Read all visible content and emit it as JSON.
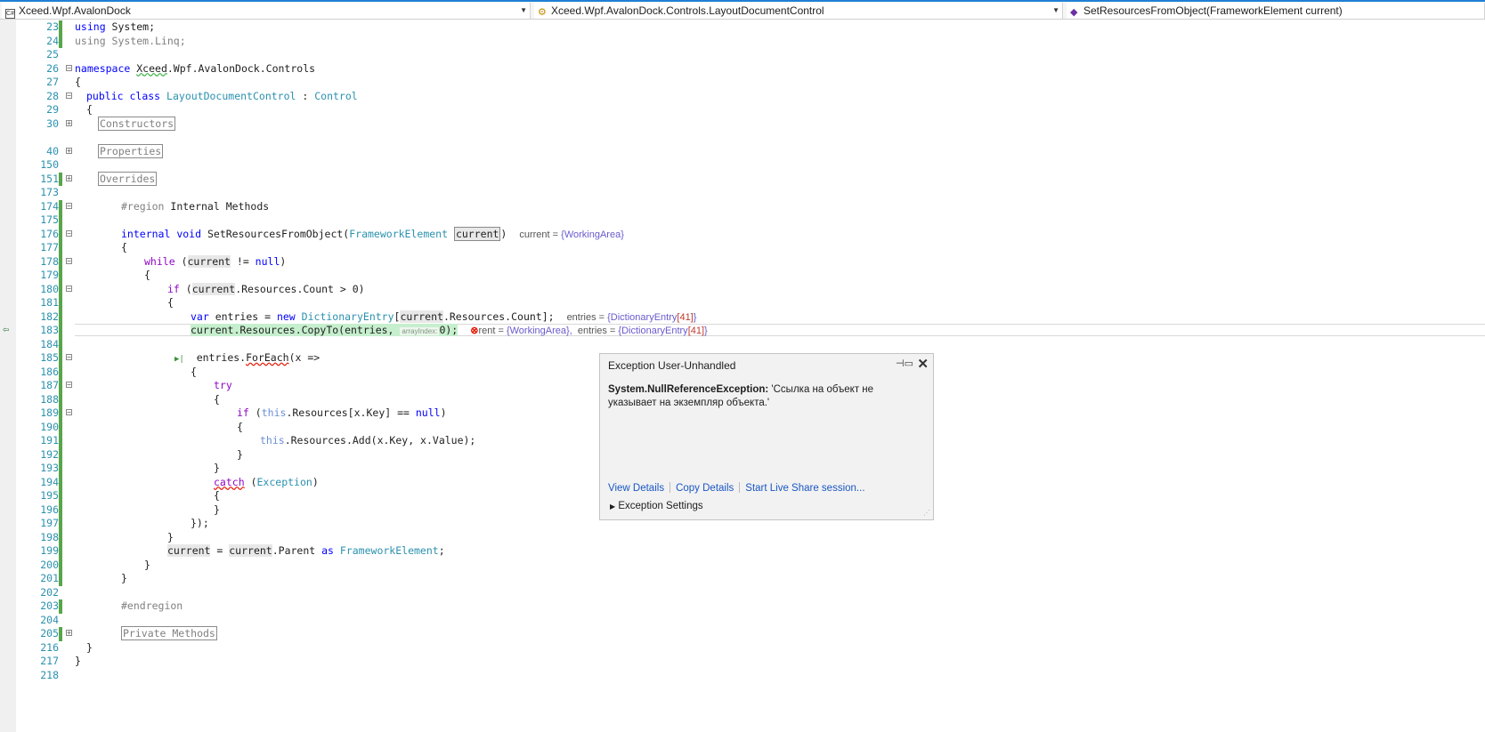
{
  "navbar": {
    "project": "Xceed.Wpf.AvalonDock",
    "class": "Xceed.Wpf.AvalonDock.Controls.LayoutDocumentControl",
    "member": "SetResourcesFromObject(FrameworkElement current)"
  },
  "lines": {
    "l23": "23",
    "l24": "24",
    "l25": "25",
    "l26": "26",
    "l27": "27",
    "l28": "28",
    "l29": "29",
    "l30": "30",
    "l40": "40",
    "l150": "150",
    "l151": "151",
    "l173": "173",
    "l174": "174",
    "l175": "175",
    "l176": "176",
    "l177": "177",
    "l178": "178",
    "l179": "179",
    "l180": "180",
    "l181": "181",
    "l182": "182",
    "l183": "183",
    "l184": "184",
    "l185": "185",
    "l186": "186",
    "l187": "187",
    "l188": "188",
    "l189": "189",
    "l190": "190",
    "l191": "191",
    "l192": "192",
    "l193": "193",
    "l194": "194",
    "l195": "195",
    "l196": "196",
    "l197": "197",
    "l198": "198",
    "l199": "199",
    "l200": "200",
    "l201": "201",
    "l202": "202",
    "l203": "203",
    "l204": "204",
    "l205": "205",
    "l216": "216",
    "l217": "217",
    "l218": "218"
  },
  "code": {
    "kw_using": "using",
    "system": " System;",
    "linq": "using System.Linq;",
    "kw_namespace": "namespace",
    "ns_xceed": "Xceed",
    "ns_rest": ".Wpf.AvalonDock.Controls",
    "brace_open": "{",
    "brace_close": "}",
    "kw_public": "public",
    "kw_class": "class",
    "class_name": "LayoutDocumentControl",
    "colon": " : ",
    "control": "Control",
    "region_constructors": "Constructors",
    "region_properties": "Properties",
    "region_overrides": "Overrides",
    "region_kw": "#region",
    "region_internal": " Internal Methods",
    "kw_internal": "internal",
    "kw_void": "void",
    "method_name": "SetResourcesFromObject",
    "paren_open": "(",
    "fe": "FrameworkElement",
    "current": "current",
    "paren_close": ")",
    "tip_current_label": "current = ",
    "tip_current_val": "{WorkingArea}",
    "kw_while": "while",
    "neq_null_a": " != ",
    "kw_null": "null",
    "kw_if": "if",
    "res_count_gt": ".Resources.Count > 0)",
    "kw_var": "var",
    "entries_assign": " entries = ",
    "kw_new": "new",
    "dict_entry": "DictionaryEntry",
    "bracket_open": "[",
    "res_count_close": ".Resources.Count];",
    "tip_entries_label": "entries = ",
    "tip_entries_type": "{DictionaryEntry",
    "tip_entries_num": "[41]",
    "tip_entries_end": "}",
    "copyto_a": "current.Resources.CopyTo(entries, ",
    "chip_array_index": "arrayIndex:",
    "copyto_b": "0);",
    "tip183_a": "rent = ",
    "tip183_b": "{WorkingArea},",
    "tip183_c": "entries = ",
    "foreach_a": "entries.",
    "foreach_m": "ForEach",
    "foreach_b": "(x =>",
    "kw_try": "try",
    "kw_this": "this",
    "res_key_a": ".Resources[",
    "x": "x",
    "res_key_b": ".Key] == ",
    "kw_null2": "null",
    "add_a": ".Resources.",
    "add_m": "Add",
    "add_b": "(x.Key, x.Value);",
    "kw_catch": "catch",
    "exception_type": "Exception",
    "close_lambda": "});",
    "parent_assign": " = ",
    "parent_b": ".Parent ",
    "kw_as": "as",
    "semicolon": ";",
    "endregion": "#endregion",
    "region_private": "Private Methods"
  },
  "popup": {
    "title": "Exception User-Unhandled",
    "exception_type": "System.NullReferenceException:",
    "exception_message": " 'Ссылка на объект не указывает на экземпляр объекта.'",
    "view_details": "View Details",
    "copy_details": "Copy Details",
    "live_share": "Start Live Share session...",
    "settings": "Exception Settings"
  }
}
